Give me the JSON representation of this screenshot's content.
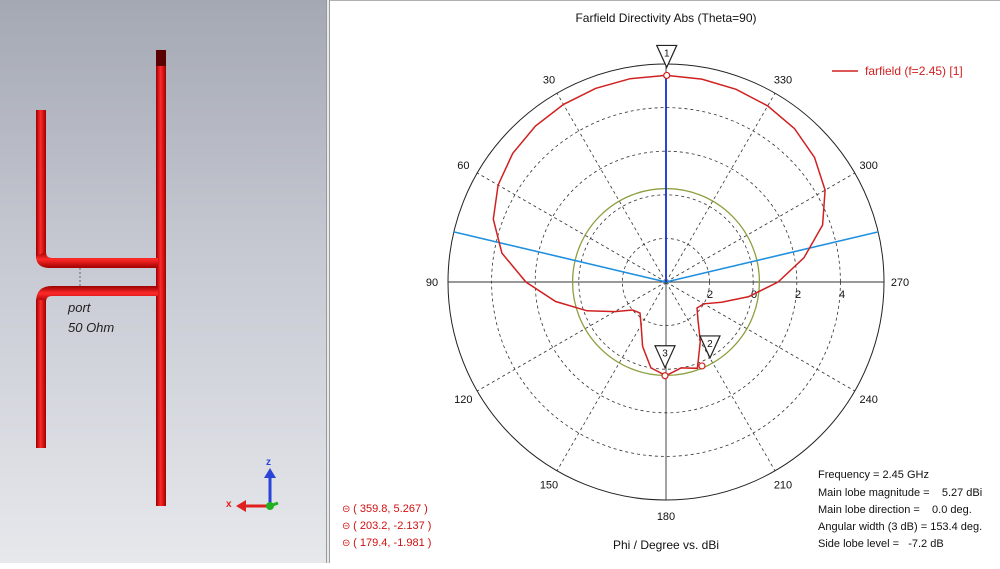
{
  "model_view": {
    "port_label": "port",
    "impedance_label": "50 Ohm",
    "axes": {
      "z": "z",
      "x": "x"
    },
    "colors": {
      "antenna": "#e01010",
      "background_top": "#a4a8b3",
      "background_bottom": "#e6e8ec"
    }
  },
  "chart_data": {
    "type": "polar-line",
    "title": "Farfield Directivity Abs (Theta=90)",
    "xlabel": "Phi / Degree vs. dBi",
    "angle_labels": [
      {
        "deg": 0,
        "text": ""
      },
      {
        "deg": 30,
        "text": "30"
      },
      {
        "deg": 60,
        "text": "60"
      },
      {
        "deg": 90,
        "text": "90"
      },
      {
        "deg": 120,
        "text": "120"
      },
      {
        "deg": 150,
        "text": "150"
      },
      {
        "deg": 180,
        "text": "180"
      },
      {
        "deg": 210,
        "text": "210"
      },
      {
        "deg": 240,
        "text": "240"
      },
      {
        "deg": 270,
        "text": "270"
      },
      {
        "deg": 300,
        "text": "300"
      },
      {
        "deg": 330,
        "text": "330"
      }
    ],
    "radial_ticks": [
      "2",
      "0",
      "2",
      "4"
    ],
    "r_range_dbi": [
      -8,
      6
    ],
    "legend": {
      "label": "farfield (f=2.45) [1]",
      "position": "top-right",
      "color": "#d02020"
    },
    "series": [
      {
        "name": "farfield (f=2.45) [1]",
        "color": "#d02020",
        "points": [
          [
            0,
            5.27
          ],
          [
            10,
            5.26
          ],
          [
            20,
            5.23
          ],
          [
            30,
            5.17
          ],
          [
            40,
            5.06
          ],
          [
            50,
            4.85
          ],
          [
            60,
            4.45
          ],
          [
            70,
            3.8
          ],
          [
            80,
            2.7
          ],
          [
            90,
            1.0
          ],
          [
            100,
            -0.8
          ],
          [
            110,
            -2.6
          ],
          [
            120,
            -4.2
          ],
          [
            130,
            -5.2
          ],
          [
            140,
            -5.4
          ],
          [
            150,
            -4.8
          ],
          [
            160,
            -3.6
          ],
          [
            170,
            -2.4
          ],
          [
            180,
            -1.98
          ],
          [
            190,
            -2.4
          ],
          [
            200,
            -2.1
          ],
          [
            210,
            -3.6
          ],
          [
            220,
            -4.8
          ],
          [
            230,
            -5.4
          ],
          [
            240,
            -5.2
          ],
          [
            250,
            -4.2
          ],
          [
            260,
            -2.6
          ],
          [
            270,
            -0.8
          ],
          [
            280,
            1.0
          ],
          [
            290,
            2.7
          ],
          [
            300,
            3.8
          ],
          [
            310,
            4.45
          ],
          [
            320,
            4.85
          ],
          [
            330,
            5.06
          ],
          [
            340,
            5.17
          ],
          [
            350,
            5.23
          ],
          [
            359.8,
            5.267
          ]
        ]
      }
    ],
    "reference_circle_dbi": -2.0,
    "reference_circle_color": "#8ca040",
    "main_lobe_color": "#1030d0",
    "beamwidth_color": "#2090e0",
    "main_lobe_direction_deg": 0.0,
    "beamwidth_deg": 153.4,
    "markers": [
      {
        "id": "1",
        "phi": 359.8,
        "value": 5.267,
        "text": "( 359.8, 5.267 )"
      },
      {
        "id": "2",
        "phi": 203.2,
        "value": -2.137,
        "text": "( 203.2, -2.137 )"
      },
      {
        "id": "3",
        "phi": 179.4,
        "value": -1.981,
        "text": "( 179.4, -1.981 )"
      }
    ],
    "info": [
      "Frequency = 2.45 GHz",
      "Main lobe magnitude =    5.27 dBi",
      "Main lobe direction =    0.0 deg.",
      "Angular width (3 dB) = 153.4 deg.",
      "Side lobe level =   -7.2 dB"
    ]
  }
}
